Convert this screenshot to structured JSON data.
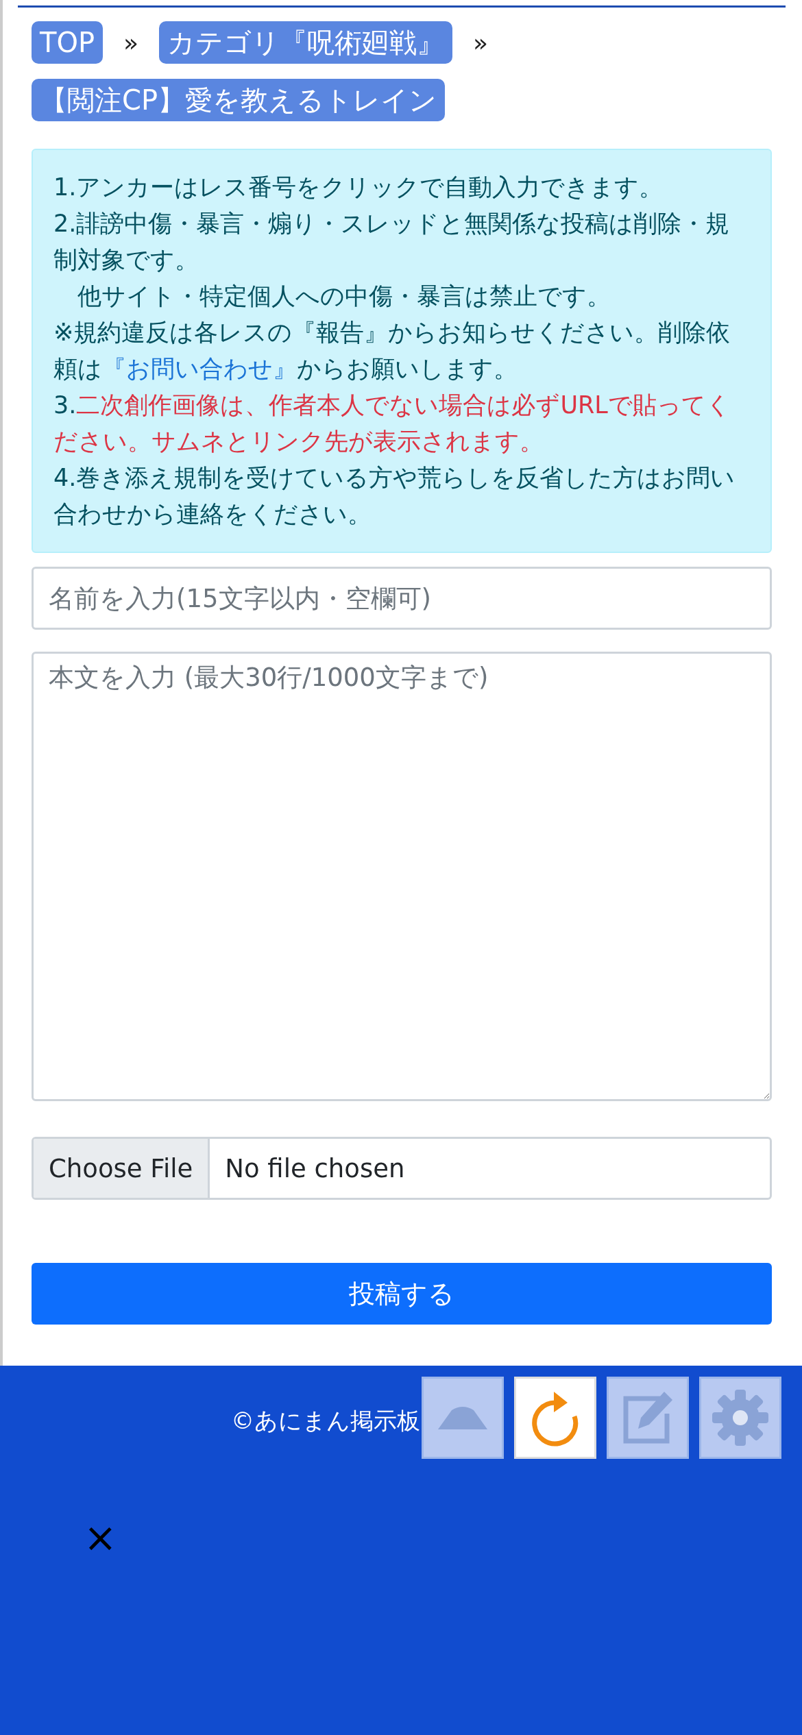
{
  "breadcrumbs": [
    {
      "label": "TOP"
    },
    {
      "label": "カテゴリ『呪術廻戦』"
    },
    {
      "label": "【閲注CP】愛を教えるトレイン"
    }
  ],
  "breadcrumb_separator": "»",
  "notice": [
    {
      "segments": [
        {
          "kind": "plain",
          "text": "1.アンカーはレス番号をクリックで自動入力できます。"
        }
      ]
    },
    {
      "segments": [
        {
          "kind": "plain",
          "text": "2.誹謗中傷・暴言・煽り・スレッドと無関係な投稿は削除・規制対象です。"
        }
      ]
    },
    {
      "segments": [
        {
          "kind": "plain",
          "text": "　他サイト・特定個人への中傷・暴言は禁止です。"
        }
      ]
    },
    {
      "segments": [
        {
          "kind": "plain",
          "text": "※規約違反は各レスの『報告』からお知らせください。削除依頼は"
        },
        {
          "kind": "link",
          "text": "『お問い合わせ』"
        },
        {
          "kind": "plain",
          "text": "からお願いします。"
        }
      ]
    },
    {
      "segments": [
        {
          "kind": "plain",
          "text": "3."
        },
        {
          "kind": "warning",
          "text": "二次創作画像は、作者本人でない場合は必ずURLで貼ってください。サムネとリンク先が表示されます。"
        }
      ]
    },
    {
      "segments": [
        {
          "kind": "plain",
          "text": "4.巻き添え規制を受けている方や荒らしを反省した方はお問い合わせから連絡をください。"
        }
      ]
    }
  ],
  "name_field": {
    "placeholder": "名前を入力(15文字以内・空欄可)"
  },
  "body_field": {
    "placeholder": "本文を入力 (最大30行/1000文字まで)"
  },
  "file_input": {
    "button": "Choose File",
    "status": "No file chosen"
  },
  "submit_button": "投稿する",
  "footer": {
    "copyright": "©あにまん掲示板",
    "close": "×"
  },
  "floating_buttons": [
    {
      "kind": "up",
      "active": false
    },
    {
      "kind": "reload",
      "active": true
    },
    {
      "kind": "edit",
      "active": false
    },
    {
      "kind": "settings",
      "active": false
    }
  ]
}
